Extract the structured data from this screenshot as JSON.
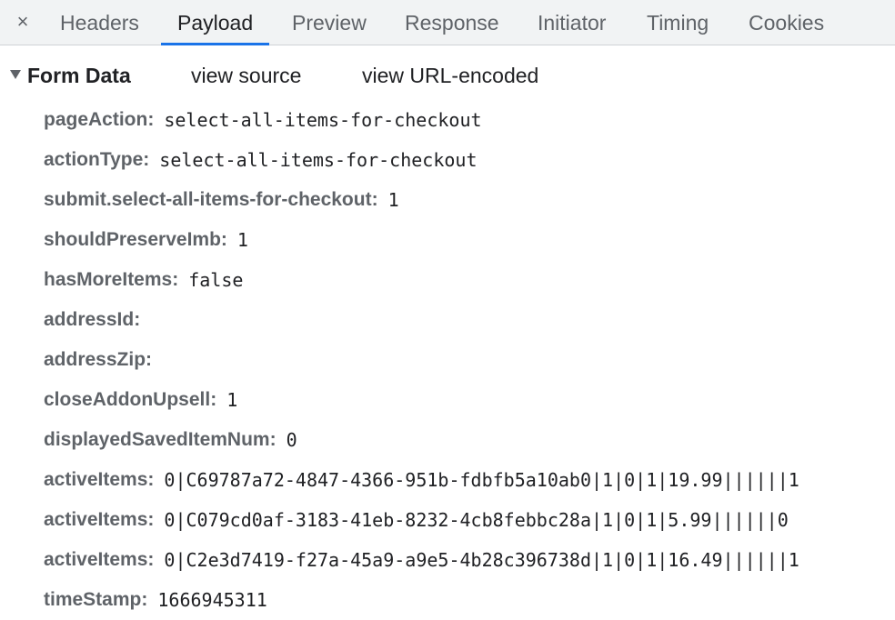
{
  "tabs": [
    {
      "label": "Headers",
      "active": false
    },
    {
      "label": "Payload",
      "active": true
    },
    {
      "label": "Preview",
      "active": false
    },
    {
      "label": "Response",
      "active": false
    },
    {
      "label": "Initiator",
      "active": false
    },
    {
      "label": "Timing",
      "active": false
    },
    {
      "label": "Cookies",
      "active": false
    }
  ],
  "close_glyph": "×",
  "section": {
    "title": "Form Data",
    "view_source": "view source",
    "view_url_encoded": "view URL-encoded"
  },
  "form_data": [
    {
      "key": "pageAction:",
      "value": "select-all-items-for-checkout"
    },
    {
      "key": "actionType:",
      "value": "select-all-items-for-checkout"
    },
    {
      "key": "submit.select-all-items-for-checkout:",
      "value": "1"
    },
    {
      "key": "shouldPreserveImb:",
      "value": "1"
    },
    {
      "key": "hasMoreItems:",
      "value": "false"
    },
    {
      "key": "addressId:",
      "value": ""
    },
    {
      "key": "addressZip:",
      "value": ""
    },
    {
      "key": "closeAddonUpsell:",
      "value": "1"
    },
    {
      "key": "displayedSavedItemNum:",
      "value": "0"
    },
    {
      "key": "activeItems:",
      "value": "0|C69787a72-4847-4366-951b-fdbfb5a10ab0|1|0|1|19.99||||||1"
    },
    {
      "key": "activeItems:",
      "value": "0|C079cd0af-3183-41eb-8232-4cb8febbc28a|1|0|1|5.99||||||0"
    },
    {
      "key": "activeItems:",
      "value": "0|C2e3d7419-f27a-45a9-a9e5-4b28c396738d|1|0|1|16.49||||||1"
    },
    {
      "key": "timeStamp:",
      "value": "1666945311"
    }
  ],
  "colors": {
    "accent": "#1a73e8",
    "key_text": "#5f6368",
    "value_text": "#202124"
  }
}
